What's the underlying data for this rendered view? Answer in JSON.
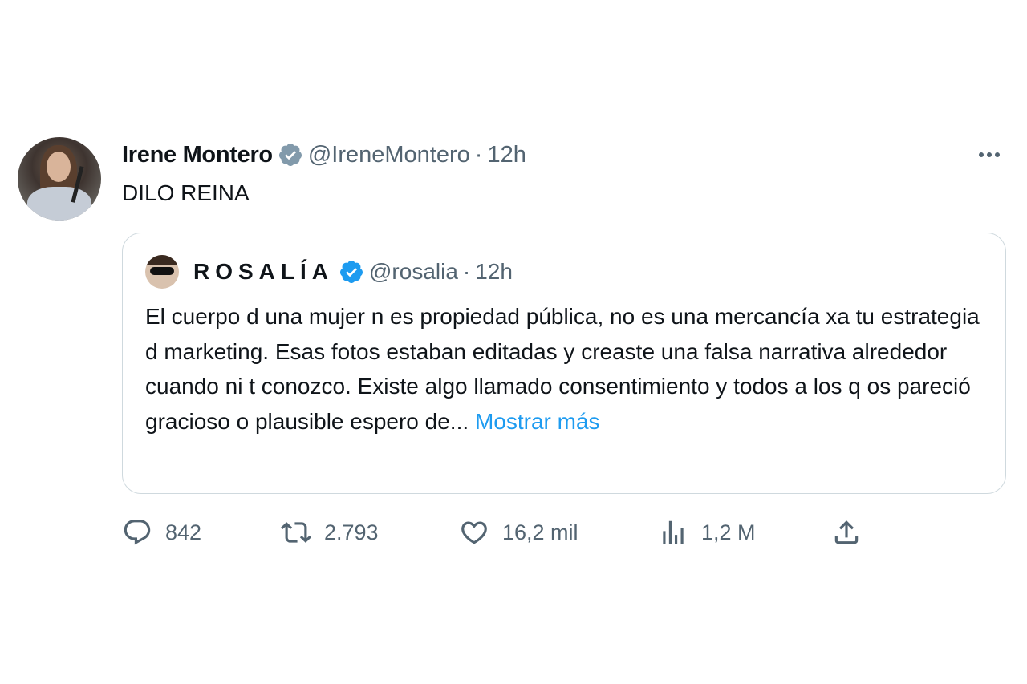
{
  "tweet": {
    "author_name": "Irene Montero",
    "handle": "@IreneMontero",
    "separator": "·",
    "time": "12h",
    "text": "DILO REINA",
    "quote": {
      "author_name": "ROSALÍA",
      "handle": "@rosalia",
      "separator": "·",
      "time": "12h",
      "text": "El cuerpo d una mujer n es propiedad pública, no es una mercancía xa tu estrategia d marketing. Esas fotos estaban editadas y creaste una falsa narrativa alrededor cuando ni t conozco. Existe algo llamado consentimiento y todos a los q os pareció gracioso o plausible espero de...",
      "show_more": "Mostrar más"
    },
    "actions": {
      "replies": "842",
      "retweets": "2.793",
      "likes": "16,2 mil",
      "views": "1,2 M"
    }
  },
  "colors": {
    "verified": "#1d9bf0",
    "link": "#1d9bf0",
    "secondary_text": "#536471",
    "border": "#cfd9de"
  },
  "icons": [
    "verified-badge-icon",
    "more-options-icon",
    "reply-icon",
    "retweet-icon",
    "like-icon",
    "views-icon",
    "share-icon"
  ]
}
